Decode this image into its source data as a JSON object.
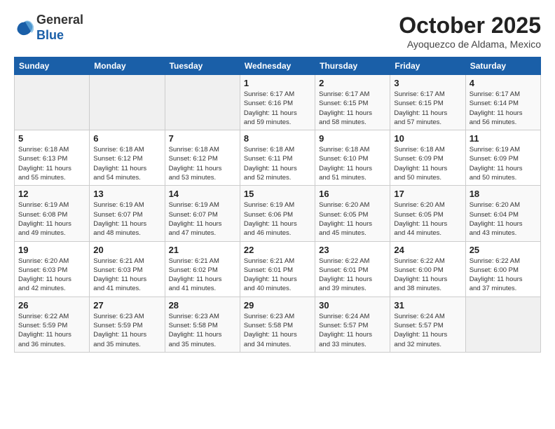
{
  "logo": {
    "general": "General",
    "blue": "Blue"
  },
  "header": {
    "month_year": "October 2025",
    "location": "Ayoquezco de Aldama, Mexico"
  },
  "days_of_week": [
    "Sunday",
    "Monday",
    "Tuesday",
    "Wednesday",
    "Thursday",
    "Friday",
    "Saturday"
  ],
  "weeks": [
    [
      {
        "day": "",
        "info": ""
      },
      {
        "day": "",
        "info": ""
      },
      {
        "day": "",
        "info": ""
      },
      {
        "day": "1",
        "info": "Sunrise: 6:17 AM\nSunset: 6:16 PM\nDaylight: 11 hours\nand 59 minutes."
      },
      {
        "day": "2",
        "info": "Sunrise: 6:17 AM\nSunset: 6:15 PM\nDaylight: 11 hours\nand 58 minutes."
      },
      {
        "day": "3",
        "info": "Sunrise: 6:17 AM\nSunset: 6:15 PM\nDaylight: 11 hours\nand 57 minutes."
      },
      {
        "day": "4",
        "info": "Sunrise: 6:17 AM\nSunset: 6:14 PM\nDaylight: 11 hours\nand 56 minutes."
      }
    ],
    [
      {
        "day": "5",
        "info": "Sunrise: 6:18 AM\nSunset: 6:13 PM\nDaylight: 11 hours\nand 55 minutes."
      },
      {
        "day": "6",
        "info": "Sunrise: 6:18 AM\nSunset: 6:12 PM\nDaylight: 11 hours\nand 54 minutes."
      },
      {
        "day": "7",
        "info": "Sunrise: 6:18 AM\nSunset: 6:12 PM\nDaylight: 11 hours\nand 53 minutes."
      },
      {
        "day": "8",
        "info": "Sunrise: 6:18 AM\nSunset: 6:11 PM\nDaylight: 11 hours\nand 52 minutes."
      },
      {
        "day": "9",
        "info": "Sunrise: 6:18 AM\nSunset: 6:10 PM\nDaylight: 11 hours\nand 51 minutes."
      },
      {
        "day": "10",
        "info": "Sunrise: 6:18 AM\nSunset: 6:09 PM\nDaylight: 11 hours\nand 50 minutes."
      },
      {
        "day": "11",
        "info": "Sunrise: 6:19 AM\nSunset: 6:09 PM\nDaylight: 11 hours\nand 50 minutes."
      }
    ],
    [
      {
        "day": "12",
        "info": "Sunrise: 6:19 AM\nSunset: 6:08 PM\nDaylight: 11 hours\nand 49 minutes."
      },
      {
        "day": "13",
        "info": "Sunrise: 6:19 AM\nSunset: 6:07 PM\nDaylight: 11 hours\nand 48 minutes."
      },
      {
        "day": "14",
        "info": "Sunrise: 6:19 AM\nSunset: 6:07 PM\nDaylight: 11 hours\nand 47 minutes."
      },
      {
        "day": "15",
        "info": "Sunrise: 6:19 AM\nSunset: 6:06 PM\nDaylight: 11 hours\nand 46 minutes."
      },
      {
        "day": "16",
        "info": "Sunrise: 6:20 AM\nSunset: 6:05 PM\nDaylight: 11 hours\nand 45 minutes."
      },
      {
        "day": "17",
        "info": "Sunrise: 6:20 AM\nSunset: 6:05 PM\nDaylight: 11 hours\nand 44 minutes."
      },
      {
        "day": "18",
        "info": "Sunrise: 6:20 AM\nSunset: 6:04 PM\nDaylight: 11 hours\nand 43 minutes."
      }
    ],
    [
      {
        "day": "19",
        "info": "Sunrise: 6:20 AM\nSunset: 6:03 PM\nDaylight: 11 hours\nand 42 minutes."
      },
      {
        "day": "20",
        "info": "Sunrise: 6:21 AM\nSunset: 6:03 PM\nDaylight: 11 hours\nand 41 minutes."
      },
      {
        "day": "21",
        "info": "Sunrise: 6:21 AM\nSunset: 6:02 PM\nDaylight: 11 hours\nand 41 minutes."
      },
      {
        "day": "22",
        "info": "Sunrise: 6:21 AM\nSunset: 6:01 PM\nDaylight: 11 hours\nand 40 minutes."
      },
      {
        "day": "23",
        "info": "Sunrise: 6:22 AM\nSunset: 6:01 PM\nDaylight: 11 hours\nand 39 minutes."
      },
      {
        "day": "24",
        "info": "Sunrise: 6:22 AM\nSunset: 6:00 PM\nDaylight: 11 hours\nand 38 minutes."
      },
      {
        "day": "25",
        "info": "Sunrise: 6:22 AM\nSunset: 6:00 PM\nDaylight: 11 hours\nand 37 minutes."
      }
    ],
    [
      {
        "day": "26",
        "info": "Sunrise: 6:22 AM\nSunset: 5:59 PM\nDaylight: 11 hours\nand 36 minutes."
      },
      {
        "day": "27",
        "info": "Sunrise: 6:23 AM\nSunset: 5:59 PM\nDaylight: 11 hours\nand 35 minutes."
      },
      {
        "day": "28",
        "info": "Sunrise: 6:23 AM\nSunset: 5:58 PM\nDaylight: 11 hours\nand 35 minutes."
      },
      {
        "day": "29",
        "info": "Sunrise: 6:23 AM\nSunset: 5:58 PM\nDaylight: 11 hours\nand 34 minutes."
      },
      {
        "day": "30",
        "info": "Sunrise: 6:24 AM\nSunset: 5:57 PM\nDaylight: 11 hours\nand 33 minutes."
      },
      {
        "day": "31",
        "info": "Sunrise: 6:24 AM\nSunset: 5:57 PM\nDaylight: 11 hours\nand 32 minutes."
      },
      {
        "day": "",
        "info": ""
      }
    ]
  ]
}
